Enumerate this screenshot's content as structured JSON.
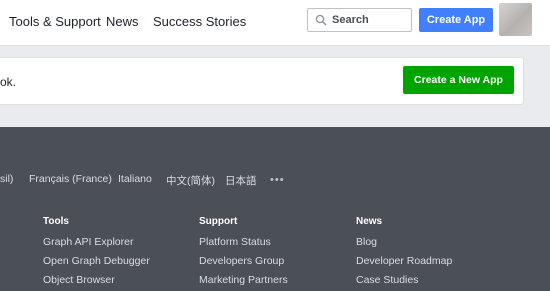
{
  "nav": {
    "links": [
      "Tools & Support",
      "News",
      "Success Stories"
    ],
    "search_placeholder": "Search",
    "create_app_label": "Create App"
  },
  "notice": {
    "message": "ok.",
    "button_label": "Create a New App"
  },
  "footer": {
    "languages": [
      "sil)",
      "Français (France)",
      "Italiano",
      "中文(简体)",
      "日本語"
    ],
    "more_label": "•••",
    "columns": [
      {
        "heading": "Tools",
        "links": [
          "Graph API Explorer",
          "Open Graph Debugger",
          "Object Browser"
        ]
      },
      {
        "heading": "Support",
        "links": [
          "Platform Status",
          "Developers Group",
          "Marketing Partners"
        ]
      },
      {
        "heading": "News",
        "links": [
          "Blog",
          "Developer Roadmap",
          "Case Studies"
        ]
      }
    ]
  },
  "colors": {
    "nav_bg": "#ffffff",
    "primary_blue": "#4080ff",
    "success_green": "#00a400",
    "footer_bg": "#4b4f56",
    "page_bg": "#e9ebee"
  }
}
